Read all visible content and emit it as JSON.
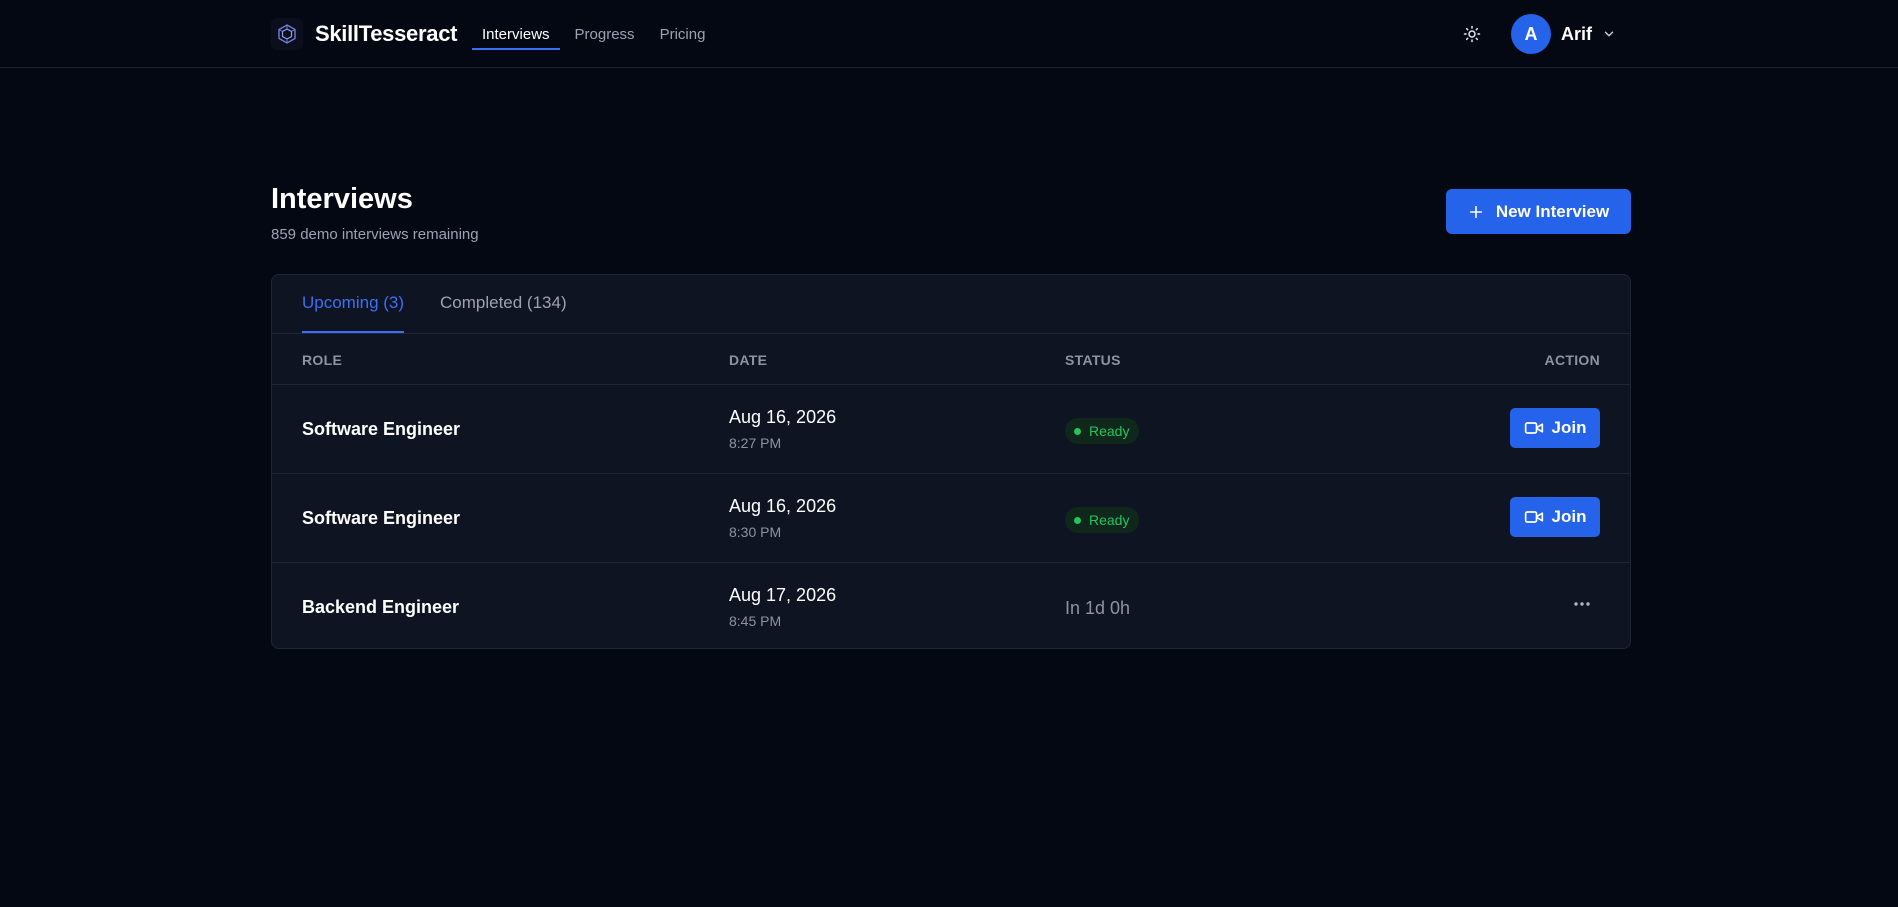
{
  "header": {
    "brand": "SkillTesseract",
    "nav": [
      {
        "label": "Interviews",
        "active": true
      },
      {
        "label": "Progress",
        "active": false
      },
      {
        "label": "Pricing",
        "active": false
      }
    ],
    "user": {
      "initial": "A",
      "name": "Arif"
    }
  },
  "page": {
    "title": "Interviews",
    "subtitle": "859 demo interviews remaining",
    "new_button": "New Interview"
  },
  "tabs": [
    {
      "label": "Upcoming (3)",
      "active": true
    },
    {
      "label": "Completed (134)",
      "active": false
    }
  ],
  "table": {
    "columns": [
      "ROLE",
      "DATE",
      "STATUS",
      "ACTION"
    ],
    "rows": [
      {
        "role": "Software Engineer",
        "date": "Aug 16, 2026",
        "time": "8:27 PM",
        "status": "Ready",
        "action": "Join"
      },
      {
        "role": "Software Engineer",
        "date": "Aug 16, 2026",
        "time": "8:30 PM",
        "status": "Ready",
        "action": "Join"
      },
      {
        "role": "Backend Engineer",
        "date": "Aug 17, 2026",
        "time": "8:45 PM",
        "status": "In 1d 0h",
        "action": "more-menu"
      }
    ]
  },
  "colors": {
    "background": "#040813",
    "card": "#0e1422",
    "accent": "#2563eb",
    "success": "#22c55e",
    "muted_text": "#9aa3b2"
  },
  "icons": [
    "logo-icon",
    "sun-icon",
    "chevron-down-icon",
    "plus-icon",
    "video-camera-icon",
    "more-horizontal-icon"
  ]
}
